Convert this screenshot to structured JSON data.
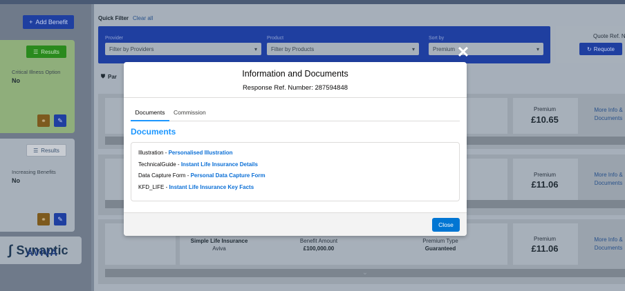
{
  "left_panel": {
    "add_benefit_label": "Add Benefit",
    "results_label": "Results",
    "card1": {
      "label": "Critical Illness Option",
      "value": "No"
    },
    "card2": {
      "label": "Increasing Benefits",
      "value": "No"
    },
    "logo_text": "Synaptic"
  },
  "quick_filter": {
    "title": "Quick Filter",
    "clear_all": "Clear all",
    "provider_label": "Provider",
    "provider_value": "Filter by Providers",
    "product_label": "Product",
    "product_value": "Filter by Products",
    "sort_label": "Sort by",
    "sort_value": "Premium",
    "quote_ref_label": "Quote Ref. N",
    "requote_label": "Requote"
  },
  "tab_partial": "Par",
  "results": [
    {
      "premium_label": "Premium",
      "premium": "£10.65",
      "more_info": "More Info & Documents"
    },
    {
      "premium_label": "Premium",
      "premium": "£11.06",
      "more_info": "More Info & Documents"
    },
    {
      "provider_logo": "AVIVA",
      "plan_name": "Simple Life Insurance",
      "provider": "Aviva",
      "benefit_label": "Benefit Amount",
      "benefit_value": "£100,000.00",
      "premium_type_label": "Premium Type",
      "premium_type_value": "Guaranteed",
      "premium_label": "Premium",
      "premium": "£11.06",
      "more_info": "More Info & Documents"
    }
  ],
  "modal": {
    "title": "Information and Documents",
    "subtitle": "Response Ref. Number: 287594848",
    "tabs": [
      "Documents",
      "Commission"
    ],
    "section_title": "Documents",
    "documents": [
      {
        "type": "Illustration",
        "link": "Personalised Illustration"
      },
      {
        "type": "TechnicalGuide",
        "link": "Instant Life Insurance Details"
      },
      {
        "type": "Data Capture Form",
        "link": "Personal Data Capture Form"
      },
      {
        "type": "KFD_LIFE",
        "link": "Instant Life Insurance Key Facts"
      }
    ],
    "close_label": "Close"
  },
  "icons": [
    "plus-icon",
    "list-icon",
    "link-icon",
    "edit-icon",
    "refresh-icon",
    "shield-icon",
    "chevron-down-icon",
    "close-icon"
  ],
  "colors": {
    "accent": "#1b96ff",
    "button": "#0176d3",
    "link": "#0b6fd6"
  }
}
